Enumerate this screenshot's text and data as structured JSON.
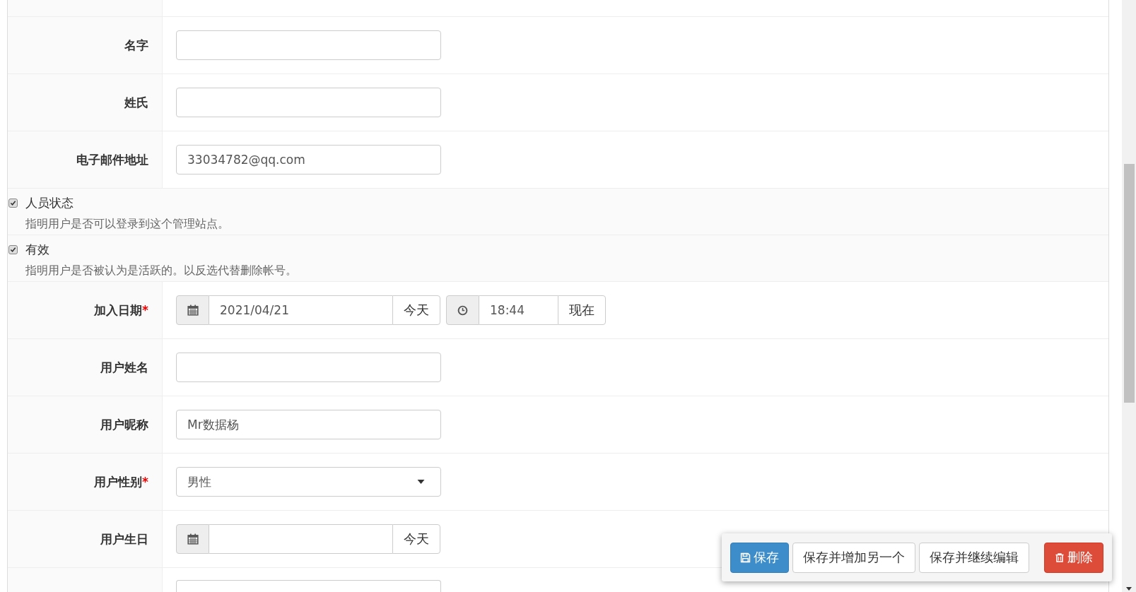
{
  "rows": [
    {
      "kind": "text",
      "label": "名字",
      "value": ""
    },
    {
      "kind": "text",
      "label": "姓氏",
      "value": ""
    },
    {
      "kind": "text",
      "label": "电子邮件地址",
      "value": "33034782@qq.com"
    },
    {
      "kind": "checkbox",
      "label": "人员状态",
      "checked": true,
      "help": "指明用户是否可以登录到这个管理站点。"
    },
    {
      "kind": "checkbox",
      "label": "有效",
      "checked": true,
      "help": "指明用户是否被认为是活跃的。以反选代替删除帐号。"
    },
    {
      "kind": "datetime",
      "label": "加入日期",
      "required_mark": "*",
      "date": "2021/04/21",
      "today": "今天",
      "time": "18:44",
      "now": "现在"
    },
    {
      "kind": "text",
      "label": "用户姓名",
      "value": ""
    },
    {
      "kind": "text",
      "label": "用户昵称",
      "value": "Mr数据杨"
    },
    {
      "kind": "select",
      "label": "用户性别",
      "required_mark": "*",
      "value": "男性"
    },
    {
      "kind": "date",
      "label": "用户生日",
      "date": "",
      "today": "今天"
    },
    {
      "kind": "partial"
    }
  ],
  "actions": [
    {
      "kind": "primary",
      "label": "保存"
    },
    {
      "kind": "default",
      "label": "保存并增加另一个"
    },
    {
      "kind": "default",
      "label": "保存并继续编辑"
    },
    {
      "kind": "danger",
      "label": "删除"
    }
  ]
}
